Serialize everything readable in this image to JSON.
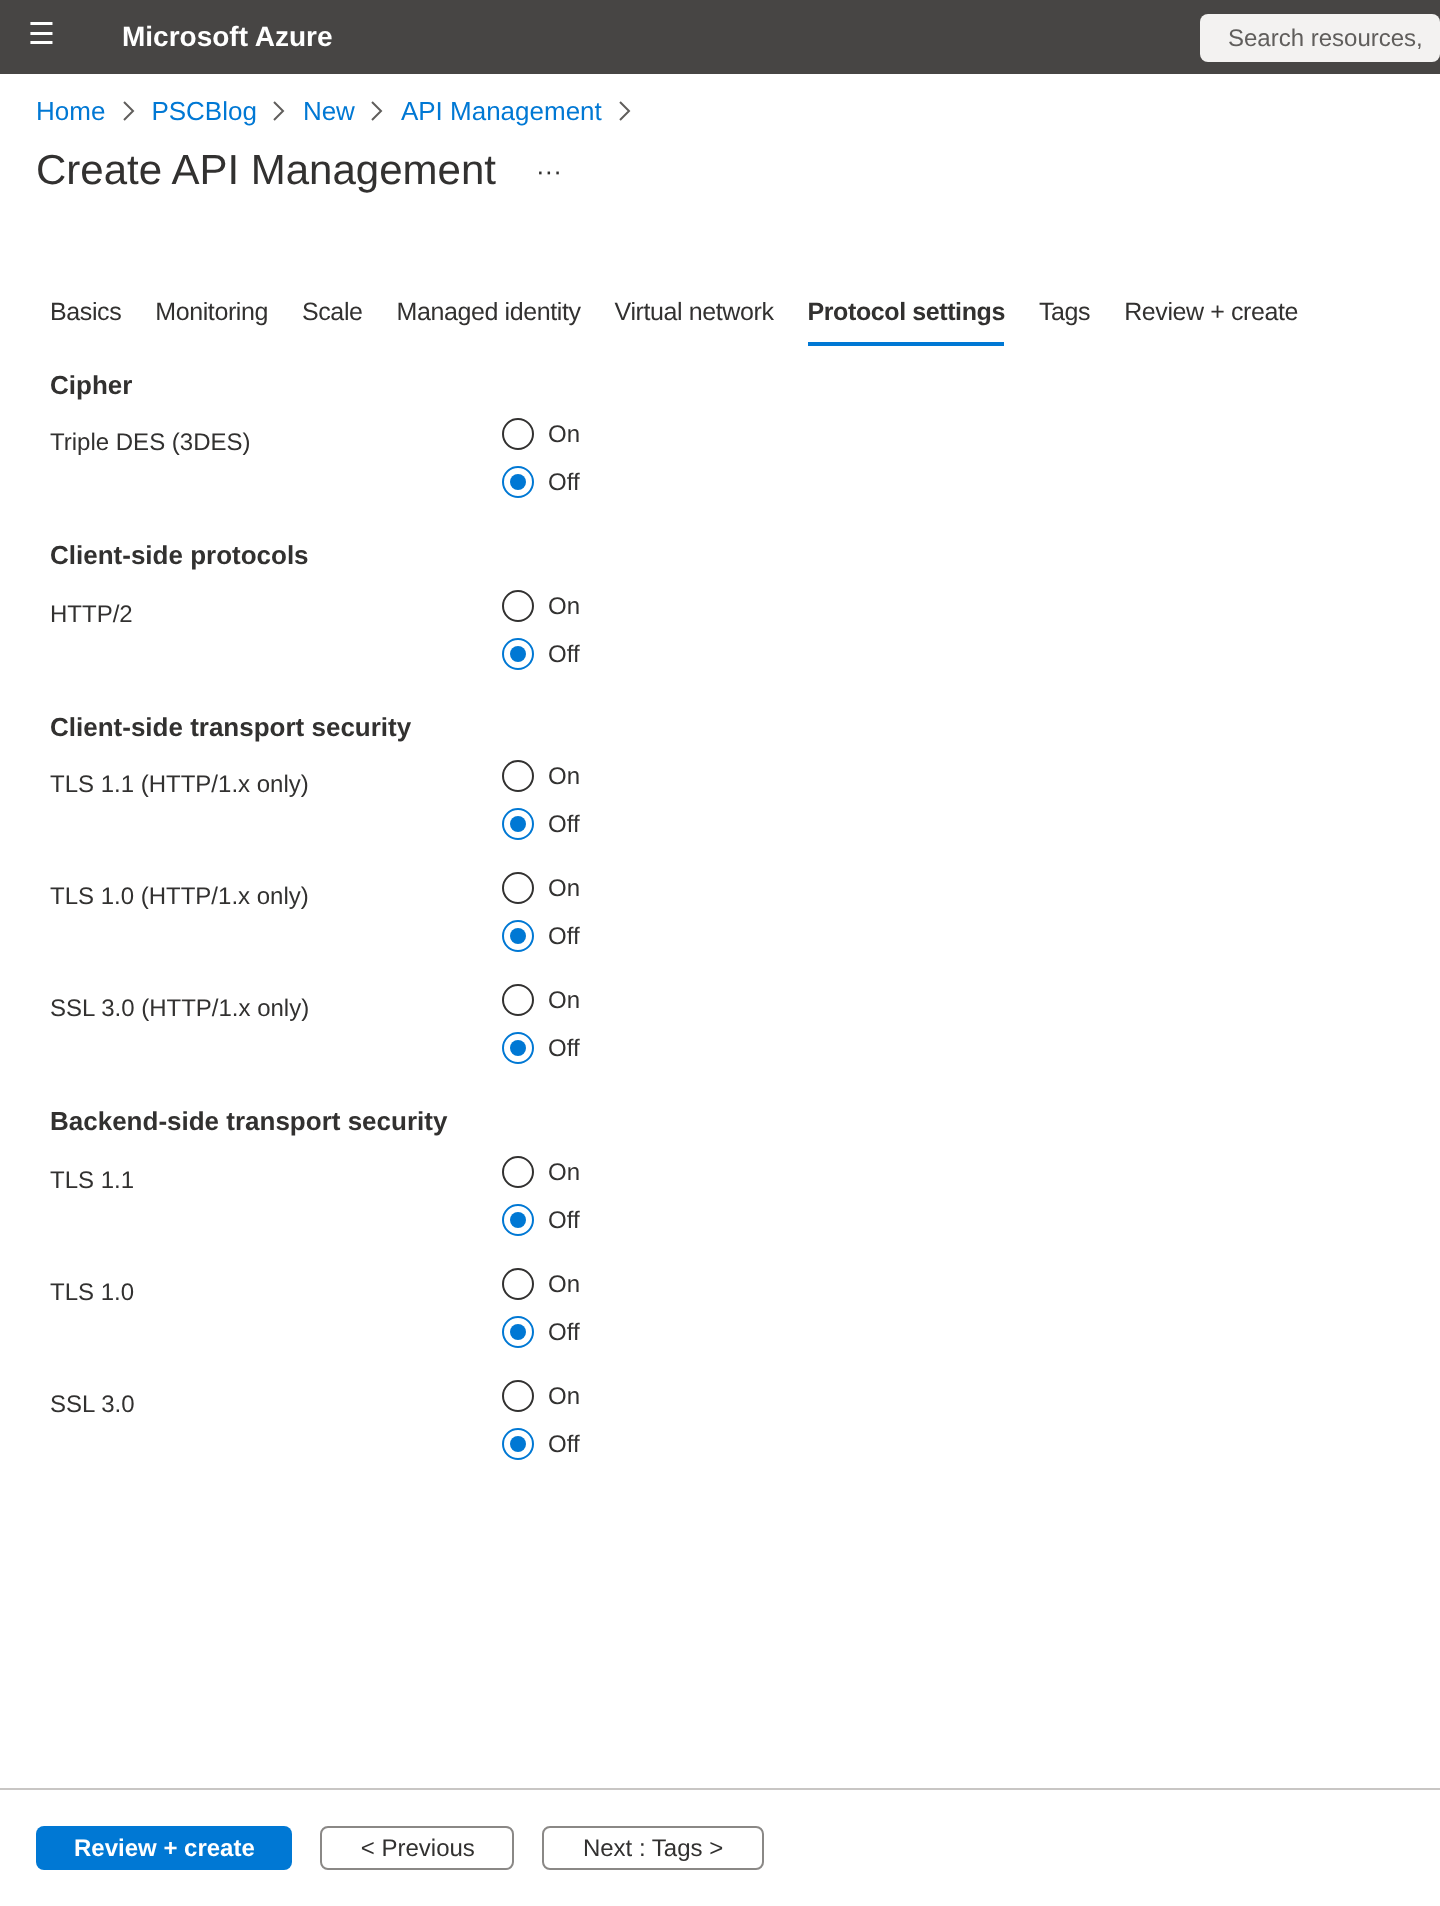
{
  "header": {
    "menu_glyph": "☰",
    "brand": "Microsoft Azure",
    "search": {
      "placeholder": "Search resources,"
    }
  },
  "breadcrumb": [
    "Home",
    "PSCBlog",
    "New",
    "API Management"
  ],
  "title": "Create API Management",
  "more": "···",
  "tabs": [
    {
      "label": "Basics",
      "selected": false
    },
    {
      "label": "Monitoring",
      "selected": false
    },
    {
      "label": "Scale",
      "selected": false
    },
    {
      "label": "Managed identity",
      "selected": false
    },
    {
      "label": "Virtual network",
      "selected": false
    },
    {
      "label": "Protocol settings",
      "selected": true
    },
    {
      "label": "Tags",
      "selected": false
    },
    {
      "label": "Review + create",
      "selected": false
    }
  ],
  "sections": [
    {
      "title": "Cipher",
      "settings": [
        {
          "label": "Triple DES (3DES)",
          "options": [
            {
              "label": "On",
              "selected": false
            },
            {
              "label": "Off",
              "selected": true
            }
          ]
        }
      ]
    },
    {
      "title": "Client-side protocols",
      "settings": [
        {
          "label": "HTTP/2",
          "options": [
            {
              "label": "On",
              "selected": false
            },
            {
              "label": "Off",
              "selected": true
            }
          ]
        }
      ]
    },
    {
      "title": "Client-side transport security",
      "settings": [
        {
          "label": "TLS 1.1 (HTTP/1.x only)",
          "options": [
            {
              "label": "On",
              "selected": false
            },
            {
              "label": "Off",
              "selected": true
            }
          ]
        },
        {
          "label": "TLS 1.0 (HTTP/1.x only)",
          "options": [
            {
              "label": "On",
              "selected": false
            },
            {
              "label": "Off",
              "selected": true
            }
          ]
        },
        {
          "label": "SSL 3.0 (HTTP/1.x only)",
          "options": [
            {
              "label": "On",
              "selected": false
            },
            {
              "label": "Off",
              "selected": true
            }
          ]
        }
      ]
    },
    {
      "title": "Backend-side transport security",
      "settings": [
        {
          "label": "TLS 1.1",
          "options": [
            {
              "label": "On",
              "selected": false
            },
            {
              "label": "Off",
              "selected": true
            }
          ]
        },
        {
          "label": "TLS 1.0",
          "options": [
            {
              "label": "On",
              "selected": false
            },
            {
              "label": "Off",
              "selected": true
            }
          ]
        },
        {
          "label": "SSL 3.0",
          "options": [
            {
              "label": "On",
              "selected": false
            },
            {
              "label": "Off",
              "selected": true
            }
          ]
        }
      ]
    }
  ],
  "footer": [
    {
      "label": "Review + create",
      "kind": "primary"
    },
    {
      "label": "< Previous",
      "kind": "secondary"
    },
    {
      "label": "Next : Tags >",
      "kind": "secondary"
    }
  ]
}
